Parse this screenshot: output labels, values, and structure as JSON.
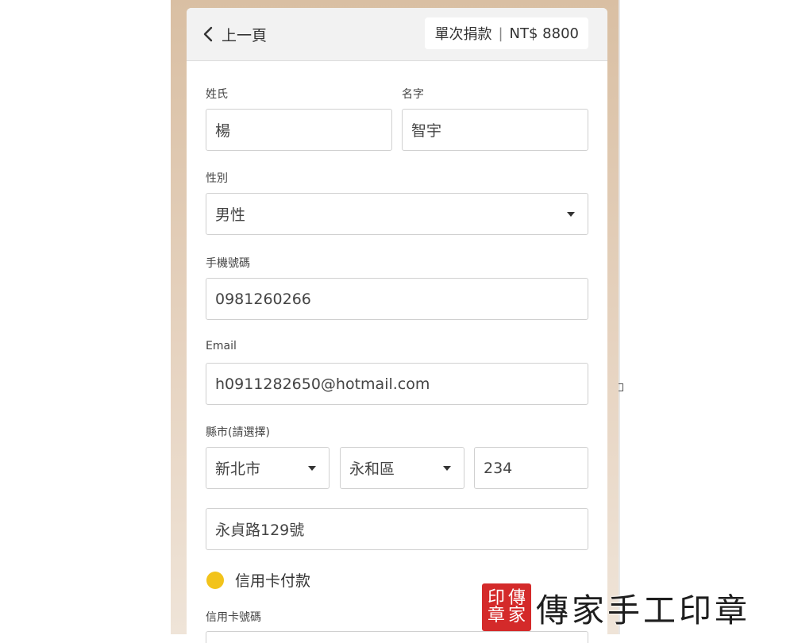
{
  "header": {
    "back_label": "上一頁",
    "donation_type": "單次捐款",
    "separator": "|",
    "amount": "NT$ 8800"
  },
  "form": {
    "last_name": {
      "label": "姓氏",
      "value": "楊"
    },
    "first_name": {
      "label": "名字",
      "value": "智宇"
    },
    "gender": {
      "label": "性別",
      "value": "男性"
    },
    "mobile": {
      "label": "手機號碼",
      "value": "0981260266"
    },
    "email": {
      "label": "Email",
      "value": "h0911282650@hotmail.com"
    },
    "region": {
      "label": "縣市(請選擇)",
      "city": "新北市",
      "district": "永和區",
      "postal_code": "234"
    },
    "address": {
      "value": "永貞路129號"
    },
    "payment": {
      "label": "信用卡付款",
      "color": "#f2c31b"
    },
    "card_number": {
      "label": "信用卡號碼"
    }
  },
  "watermark": {
    "seal_chars": [
      "傳",
      "印",
      "家",
      "章"
    ],
    "text": "傳家手工印章",
    "seal_color": "#d42a2a"
  }
}
